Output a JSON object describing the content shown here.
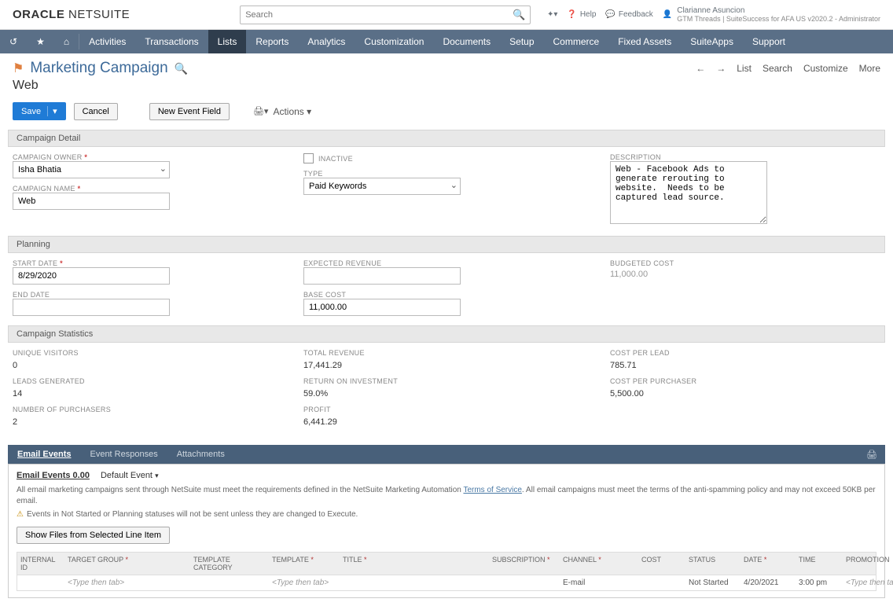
{
  "header": {
    "logo": "ORACLE NETSUITE",
    "search_placeholder": "Search",
    "help": "Help",
    "feedback": "Feedback",
    "user_name": "Clarianne Asuncion",
    "user_role": "GTM Threads | SuiteSuccess for AFA US v2020.2 - Administrator"
  },
  "nav": {
    "items": [
      "Activities",
      "Transactions",
      "Lists",
      "Reports",
      "Analytics",
      "Customization",
      "Documents",
      "Setup",
      "Commerce",
      "Fixed Assets",
      "SuiteApps",
      "Support"
    ],
    "active": "Lists"
  },
  "page": {
    "title": "Marketing Campaign",
    "subtitle": "Web",
    "right_actions": [
      "List",
      "Search",
      "Customize",
      "More"
    ]
  },
  "buttons": {
    "save": "Save",
    "cancel": "Cancel",
    "new_event": "New Event Field",
    "actions": "Actions"
  },
  "sections": {
    "campaign_detail": "Campaign Detail",
    "planning": "Planning",
    "campaign_statistics": "Campaign Statistics"
  },
  "detail": {
    "campaign_owner_label": "CAMPAIGN OWNER",
    "campaign_owner": "Isha Bhatia",
    "campaign_name_label": "CAMPAIGN NAME",
    "campaign_name": "Web",
    "inactive_label": "INACTIVE",
    "type_label": "TYPE",
    "type": "Paid Keywords",
    "description_label": "DESCRIPTION",
    "description": "Web - Facebook Ads to generate rerouting to website.  Needs to be captured lead source."
  },
  "planning": {
    "start_date_label": "START DATE",
    "start_date": "8/29/2020",
    "end_date_label": "END DATE",
    "end_date": "",
    "expected_rev_label": "EXPECTED REVENUE",
    "expected_rev": "",
    "base_cost_label": "BASE COST",
    "base_cost": "11,000.00",
    "budgeted_cost_label": "BUDGETED COST",
    "budgeted_cost": "11,000.00"
  },
  "stats": {
    "unique_visitors_label": "UNIQUE VISITORS",
    "unique_visitors": "0",
    "leads_generated_label": "LEADS GENERATED",
    "leads_generated": "14",
    "number_purchasers_label": "NUMBER OF PURCHASERS",
    "number_purchasers": "2",
    "total_revenue_label": "TOTAL REVENUE",
    "total_revenue": "17,441.29",
    "roi_label": "RETURN ON INVESTMENT",
    "roi": "59.0%",
    "profit_label": "PROFIT",
    "profit": "6,441.29",
    "cost_per_lead_label": "COST PER LEAD",
    "cost_per_lead": "785.71",
    "cost_per_purchaser_label": "COST PER PURCHASER",
    "cost_per_purchaser": "5,500.00"
  },
  "subtabs": {
    "items": [
      "Email Events",
      "Event Responses",
      "Attachments"
    ],
    "active": "Email Events"
  },
  "email_events": {
    "inner_tab_1": "Email Events 0.00",
    "inner_tab_2": "Default Event",
    "policy_text_1": "All email marketing campaigns sent through NetSuite must meet the requirements defined in the NetSuite Marketing Automation ",
    "policy_link": "Terms of Service",
    "policy_text_2": ". All email campaigns must meet the terms of the anti-spamming policy and may not exceed 50KB per email.",
    "warn_text": "Events in Not Started or Planning statuses will not be sent unless they are changed to Execute.",
    "show_files_btn": "Show Files from Selected Line Item",
    "columns": {
      "internal_id": "INTERNAL ID",
      "target_group": "TARGET GROUP",
      "template_category": "TEMPLATE CATEGORY",
      "template": "TEMPLATE",
      "title": "TITLE",
      "subscription": "SUBSCRIPTION",
      "channel": "CHANNEL",
      "cost": "COST",
      "status": "STATUS",
      "date": "DATE",
      "time": "TIME",
      "promotion": "PROMOTION"
    },
    "row": {
      "target_group": "<Type then tab>",
      "template": "<Type then tab>",
      "channel": "E-mail",
      "status": "Not Started",
      "date": "4/20/2021",
      "time": "3:00 pm",
      "promotion": "<Type then tab>"
    }
  }
}
